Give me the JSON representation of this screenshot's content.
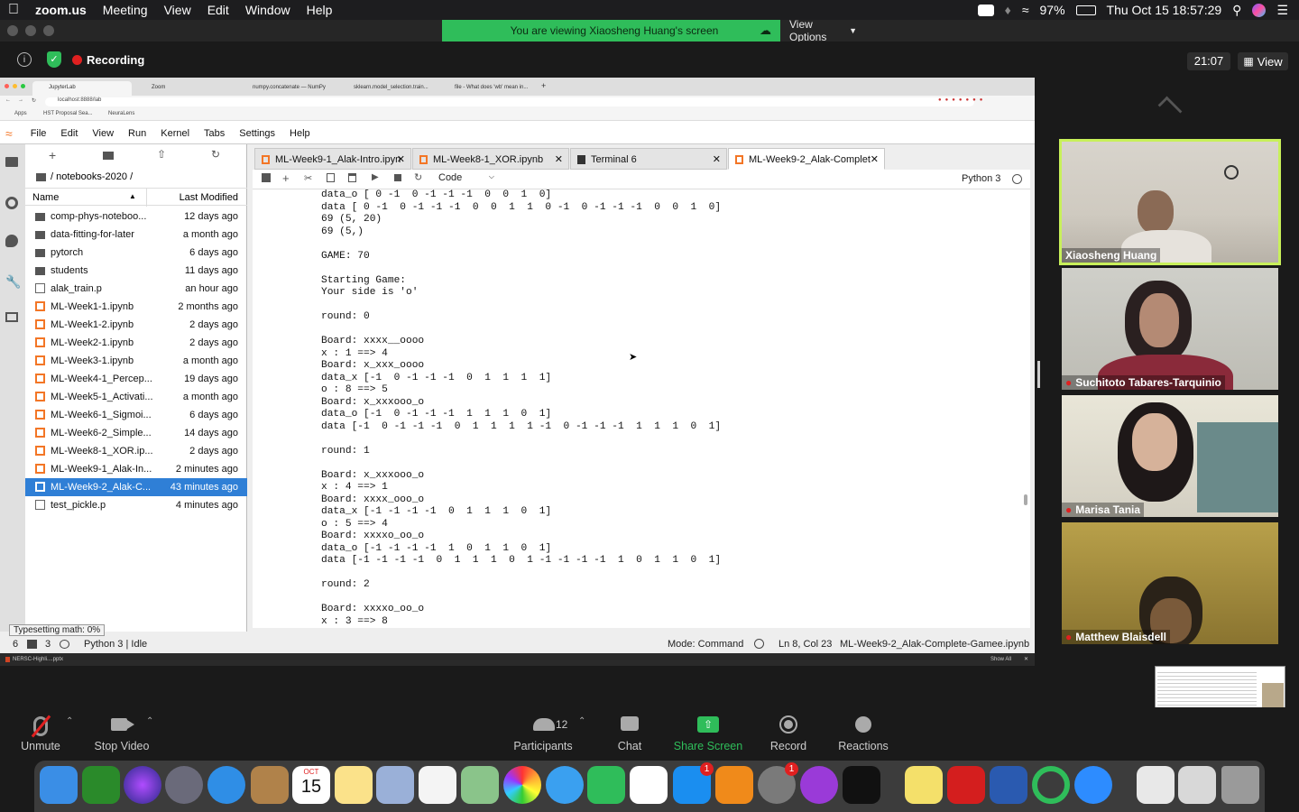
{
  "menubar": {
    "app": "zoom.us",
    "items": [
      "Meeting",
      "View",
      "Edit",
      "Window",
      "Help"
    ],
    "battery": "97%",
    "clock": "Thu Oct 15  18:57:29"
  },
  "banner": {
    "message": "You are viewing Xiaosheng Huang's screen",
    "view_options": "View Options"
  },
  "recording": {
    "label": "Recording",
    "timer": "21:07",
    "view_label": "View"
  },
  "chrome": {
    "tabs": [
      "JupyterLab",
      "Zoom",
      "numpy.concatenate — NumPy",
      "sklearn.model_selection.train...",
      "file - What does 'wb' mean in..."
    ],
    "address": "localhost:8888/lab",
    "bookmarks": [
      "Apps",
      "HST Proposal Sea...",
      "NeuraLens"
    ],
    "download_file": "NERSC-Highli....pptx",
    "show_all": "Show All"
  },
  "jupyter": {
    "menu": [
      "File",
      "Edit",
      "View",
      "Run",
      "Kernel",
      "Tabs",
      "Settings",
      "Help"
    ],
    "breadcrumb": "/ notebooks-2020 /",
    "col_name": "Name",
    "col_modified": "Last Modified",
    "files": [
      {
        "name": "comp-phys-noteboo...",
        "modified": "12 days ago",
        "type": "folder"
      },
      {
        "name": "data-fitting-for-later",
        "modified": "a month ago",
        "type": "folder"
      },
      {
        "name": "pytorch",
        "modified": "6 days ago",
        "type": "folder"
      },
      {
        "name": "students",
        "modified": "11 days ago",
        "type": "folder"
      },
      {
        "name": "alak_train.p",
        "modified": "an hour ago",
        "type": "file"
      },
      {
        "name": "ML-Week1-1.ipynb",
        "modified": "2 months ago",
        "type": "notebook"
      },
      {
        "name": "ML-Week1-2.ipynb",
        "modified": "2 days ago",
        "type": "notebook"
      },
      {
        "name": "ML-Week2-1.ipynb",
        "modified": "2 days ago",
        "type": "notebook"
      },
      {
        "name": "ML-Week3-1.ipynb",
        "modified": "a month ago",
        "type": "notebook"
      },
      {
        "name": "ML-Week4-1_Percep...",
        "modified": "19 days ago",
        "type": "notebook"
      },
      {
        "name": "ML-Week5-1_Activati...",
        "modified": "a month ago",
        "type": "notebook"
      },
      {
        "name": "ML-Week6-1_Sigmoi...",
        "modified": "6 days ago",
        "type": "notebook"
      },
      {
        "name": "ML-Week6-2_Simple...",
        "modified": "14 days ago",
        "type": "notebook"
      },
      {
        "name": "ML-Week8-1_XOR.ip...",
        "modified": "2 days ago",
        "type": "notebook"
      },
      {
        "name": "ML-Week9-1_Alak-In...",
        "modified": "2 minutes ago",
        "type": "notebook"
      },
      {
        "name": "ML-Week9-2_Alak-C...",
        "modified": "43 minutes ago",
        "type": "notebook",
        "selected": true
      },
      {
        "name": "test_pickle.p",
        "modified": "4 minutes ago",
        "type": "file"
      }
    ],
    "tabs": [
      "ML-Week9-1_Alak-Intro.ipyn",
      "ML-Week8-1_XOR.ipynb",
      "Terminal 6",
      "ML-Week9-2_Alak-Complet"
    ],
    "cell_type": "Code",
    "kernel": "Python 3",
    "output": "data_o [ 0 -1  0 -1 -1 -1  0  0  1  0]\ndata [ 0 -1  0 -1 -1 -1  0  0  1  1  0 -1  0 -1 -1 -1  0  0  1  0]\n69 (5, 20)\n69 (5,)\n\nGAME: 70\n\nStarting Game:\nYour side is 'o'\n\nround: 0\n\nBoard: xxxx__oooo\nx : 1 ==> 4\nBoard: x_xxx_oooo\ndata_x [-1  0 -1 -1 -1  0  1  1  1  1]\no : 8 ==> 5\nBoard: x_xxxooo_o\ndata_o [-1  0 -1 -1 -1  1  1  1  0  1]\ndata [-1  0 -1 -1 -1  0  1  1  1  1 -1  0 -1 -1 -1  1  1  1  0  1]\n\nround: 1\n\nBoard: x_xxxooo_o\nx : 4 ==> 1\nBoard: xxxx_ooo_o\ndata_x [-1 -1 -1 -1  0  1  1  1  0  1]\no : 5 ==> 4\nBoard: xxxxo_oo_o\ndata_o [-1 -1 -1 -1  1  0  1  1  0  1]\ndata [-1 -1 -1 -1  0  1  1  1  0  1 -1 -1 -1 -1  1  0  1  1  0  1]\n\nround: 2\n\nBoard: xxxxo_oo_o\nx : 3 ==> 8",
    "tooltip": "Typesetting math: 0%",
    "status_left_a": "6",
    "status_left_b": "3",
    "status_kernel": "Python 3 | Idle",
    "status_mode": "Mode: Command",
    "status_pos": "Ln 8, Col 23",
    "status_file": "ML-Week9-2_Alak-Complete-Gamee.ipynb"
  },
  "participants": [
    "Xiaosheng Huang",
    "Suchitoto Tabares-Tarquinio",
    "Marisa Tania",
    "Matthew Blaisdell"
  ],
  "toolbar": {
    "unmute": "Unmute",
    "stop_video": "Stop Video",
    "participants": "Participants",
    "participants_count": "12",
    "chat": "Chat",
    "share": "Share Screen",
    "record": "Record",
    "reactions": "Reactions"
  },
  "dock": {
    "calendar_month": "OCT",
    "calendar_day": "15",
    "badge_appstore": "1",
    "badge_prefs": "1"
  },
  "colors": {
    "accent_green": "#2fbd5a",
    "jupyter_blue": "#2f7fd6",
    "notebook_orange": "#f37626",
    "record_red": "#e02020"
  }
}
